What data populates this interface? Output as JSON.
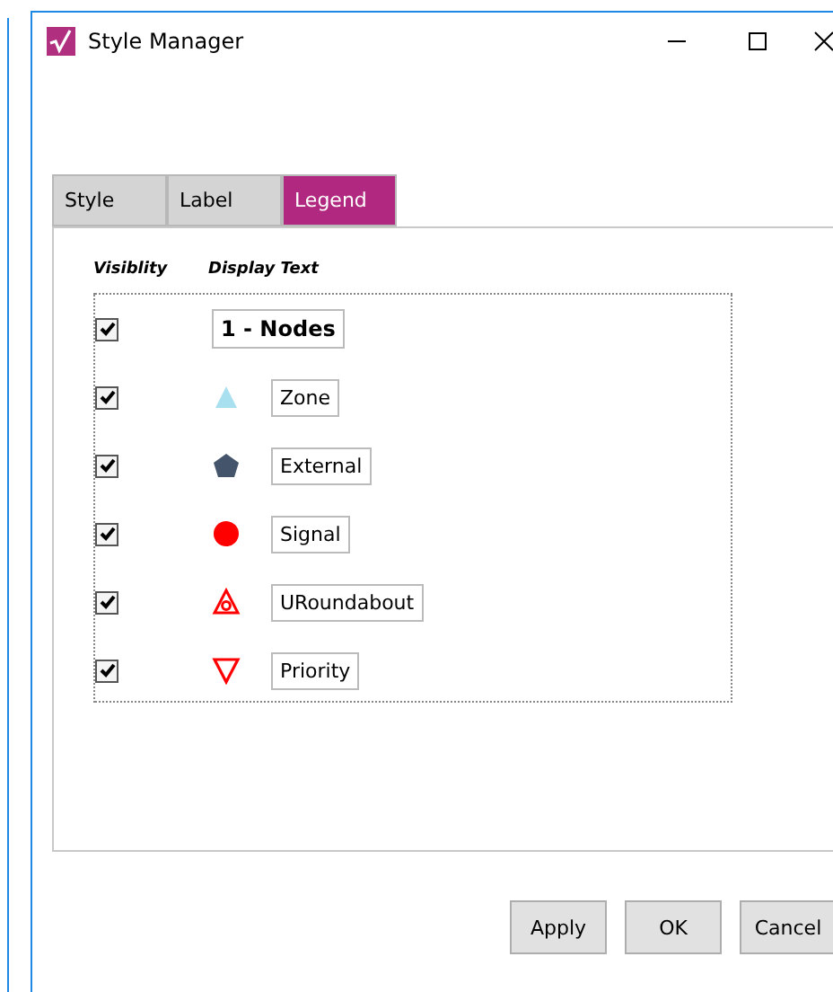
{
  "window": {
    "title": "Style Manager"
  },
  "tabs": [
    {
      "label": "Style",
      "selected": false
    },
    {
      "label": "Label",
      "selected": false
    },
    {
      "label": "Legend",
      "selected": true
    }
  ],
  "legend": {
    "columns": [
      "Visiblity",
      "Display Text"
    ],
    "rows": [
      {
        "kind": "group",
        "checked": true,
        "text": "1 - Nodes"
      },
      {
        "kind": "triangle-up",
        "color": "#a8e0f0",
        "checked": true,
        "text": "Zone"
      },
      {
        "kind": "pentagon",
        "color": "#44546a",
        "checked": true,
        "text": "External"
      },
      {
        "kind": "circle",
        "color": "#ff0000",
        "checked": true,
        "text": "Signal"
      },
      {
        "kind": "roundabout",
        "color": "#ff0000",
        "checked": true,
        "text": "URoundabout"
      },
      {
        "kind": "triangle-down",
        "color": "#ff0000",
        "checked": true,
        "text": "Priority"
      }
    ]
  },
  "buttons": [
    "Apply",
    "OK",
    "Cancel"
  ]
}
